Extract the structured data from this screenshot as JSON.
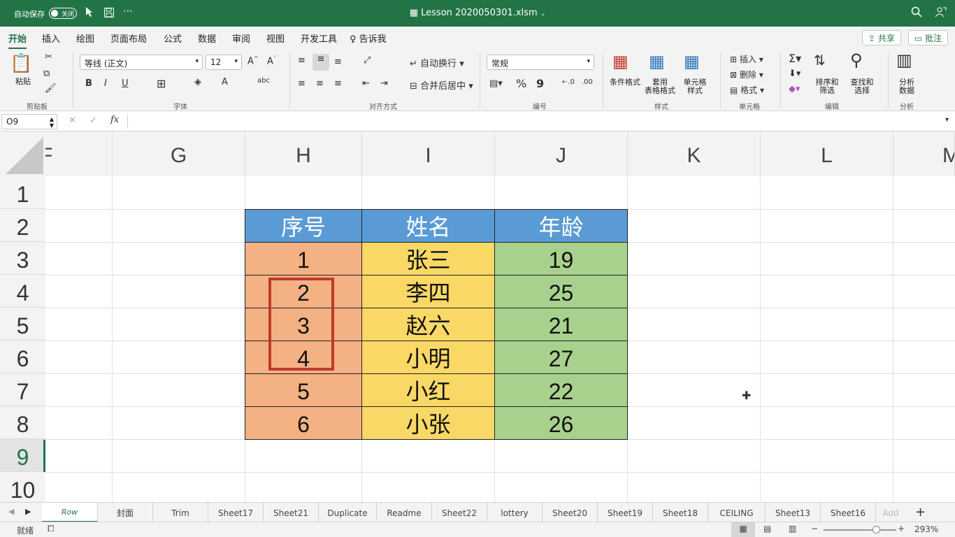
{
  "titlebar": {
    "autosave": "自动保存",
    "toggle": "关闭",
    "doc_title": "Lesson 2020050301.xlsm",
    "icons": [
      "cursor-icon",
      "save-icon",
      "more-icon",
      "search-icon",
      "share-person-icon"
    ]
  },
  "menu": {
    "items": [
      "开始",
      "插入",
      "绘图",
      "页面布局",
      "公式",
      "数据",
      "审阅",
      "视图",
      "开发工具",
      "告诉我"
    ],
    "share": "共享",
    "comment": "批注"
  },
  "ribbon": {
    "clipboard": {
      "paste": "粘贴",
      "label": "剪贴板"
    },
    "font": {
      "name": "等线 (正文)",
      "size": "12",
      "label": "字体",
      "bold": "B",
      "italic": "I",
      "underline": "U"
    },
    "align": {
      "wrap": "自动换行",
      "merge": "合并后居中",
      "label": "对齐方式"
    },
    "number": {
      "format": "常规",
      "label": "编号",
      "percent": "%",
      "comma": "9"
    },
    "styles": {
      "conditional": "条件格式",
      "table_l1": "套用",
      "table_l2": "表格格式",
      "cell_l1": "单元格",
      "cell_l2": "样式",
      "label": "样式"
    },
    "cells": {
      "insert": "插入",
      "delete": "删除",
      "format": "格式",
      "label": "单元格"
    },
    "editing": {
      "sort_l1": "排序和",
      "sort_l2": "筛选",
      "find_l1": "查找和",
      "find_l2": "选择",
      "label": "编辑"
    },
    "analysis": {
      "l1": "分析",
      "l2": "数据",
      "label": "分析"
    }
  },
  "formula": {
    "namebox": "O9",
    "cancel": "✕",
    "enter": "✓",
    "fx": "fx",
    "value": ""
  },
  "columns": [
    "F",
    "G",
    "H",
    "I",
    "J",
    "K",
    "L",
    "M"
  ],
  "rows": [
    "1",
    "2",
    "3",
    "4",
    "5",
    "6",
    "7",
    "8",
    "9",
    "10"
  ],
  "table": {
    "headers": [
      "序号",
      "姓名",
      "年龄"
    ],
    "rows": [
      [
        "1",
        "张三",
        "19"
      ],
      [
        "2",
        "李四",
        "25"
      ],
      [
        "3",
        "赵六",
        "21"
      ],
      [
        "4",
        "小明",
        "27"
      ],
      [
        "5",
        "小红",
        "22"
      ],
      [
        "6",
        "小张",
        "26"
      ]
    ]
  },
  "colors": {
    "accent": "#227447",
    "header_blue": "#5b9bd5",
    "col_orange": "#f4b183",
    "col_yellow": "#f9d866",
    "col_green": "#a9d18e",
    "highlight_box": "#c0392b"
  },
  "tabs": [
    "Row",
    "封面",
    "Trim",
    "Sheet17",
    "Sheet21",
    "Duplicate",
    "Readme",
    "Sheet22",
    "lottery",
    "Sheet20",
    "Sheet19",
    "Sheet18",
    "CEILING",
    "Sheet13",
    "Sheet16",
    "Add"
  ],
  "status": {
    "ready": "就绪",
    "zoom": "293%",
    "minus": "−",
    "plus": "+"
  }
}
